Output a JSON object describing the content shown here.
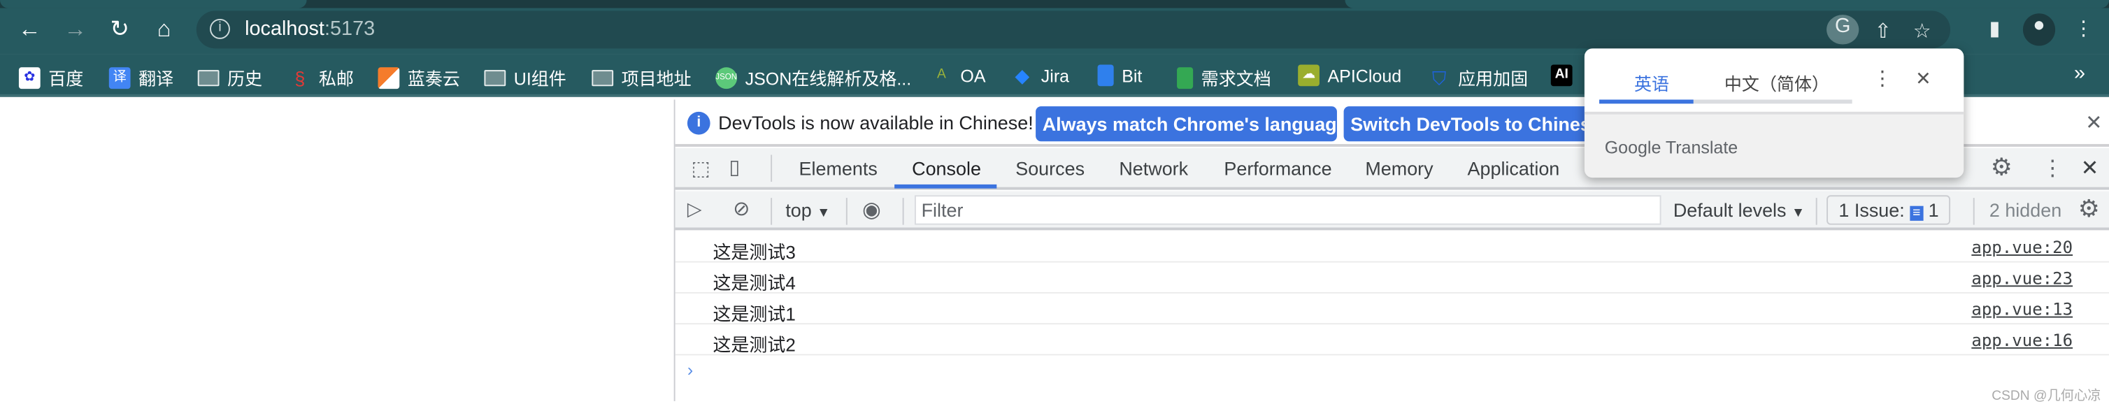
{
  "browser": {
    "url_host": "localhost",
    "url_port": ":5173",
    "nav_icons": [
      "back-arrow-icon",
      "forward-arrow-icon",
      "reload-icon",
      "home-icon"
    ],
    "bookmarks": [
      {
        "label": "百度",
        "icon": "baidu-icon",
        "color": "#ffffff"
      },
      {
        "label": "翻译",
        "icon": "translate-icon",
        "color": "#4285f4"
      },
      {
        "label": "历史",
        "icon": "folder-icon"
      },
      {
        "label": "私邮",
        "icon": "mail-icon",
        "color": "#e53935"
      },
      {
        "label": "蓝奏云",
        "icon": "lanzou-icon",
        "color": "#f57c2b"
      },
      {
        "label": "UI组件",
        "icon": "folder-icon"
      },
      {
        "label": "项目地址",
        "icon": "folder-icon"
      },
      {
        "label": "JSON在线解析及格...",
        "icon": "json-icon",
        "color": "#5cc97a"
      },
      {
        "label": "OA",
        "icon": "oa-icon",
        "color": "#9ab23a"
      },
      {
        "label": "Jira",
        "icon": "jira-icon",
        "color": "#2684ff"
      },
      {
        "label": "Bit",
        "icon": "bit-icon",
        "color": "#2f80ed"
      },
      {
        "label": "需求文档",
        "icon": "sheet-icon",
        "color": "#34a853"
      },
      {
        "label": "APICloud",
        "icon": "apicloud-icon",
        "color": "#9aae2e"
      },
      {
        "label": "应用加固",
        "icon": "shield-icon",
        "color": "#1e63e0"
      },
      {
        "label": "AI",
        "icon": "ai-icon",
        "color": "#000000"
      }
    ],
    "more_bookmarks": "»"
  },
  "devtools": {
    "infobar": {
      "message": "DevTools is now available in Chinese!",
      "button1": "Always match Chrome's language",
      "button2": "Switch DevTools to Chinese"
    },
    "tabs": [
      "Elements",
      "Console",
      "Sources",
      "Network",
      "Performance",
      "Memory",
      "Application"
    ],
    "active_tab": "Console",
    "console_toolbar": {
      "context": "top",
      "filter_placeholder": "Filter",
      "levels": "Default levels",
      "issues_label": "1 Issue:",
      "issues_count": "1",
      "hidden": "2 hidden"
    },
    "messages": [
      {
        "text": "这是测试3",
        "source": "app.vue:20"
      },
      {
        "text": "这是测试4",
        "source": "app.vue:23"
      },
      {
        "text": "这是测试1",
        "source": "app.vue:13"
      },
      {
        "text": "这是测试2",
        "source": "app.vue:16"
      }
    ],
    "prompt": "›"
  },
  "translate_popup": {
    "lang_source": "英语",
    "lang_target": "中文（简体）",
    "brand": "Google Translate",
    "progress": 0.37
  },
  "watermark": "CSDN @几何心凉",
  "colors": {
    "accent": "#3b73df",
    "toolbar": "#265a60"
  }
}
